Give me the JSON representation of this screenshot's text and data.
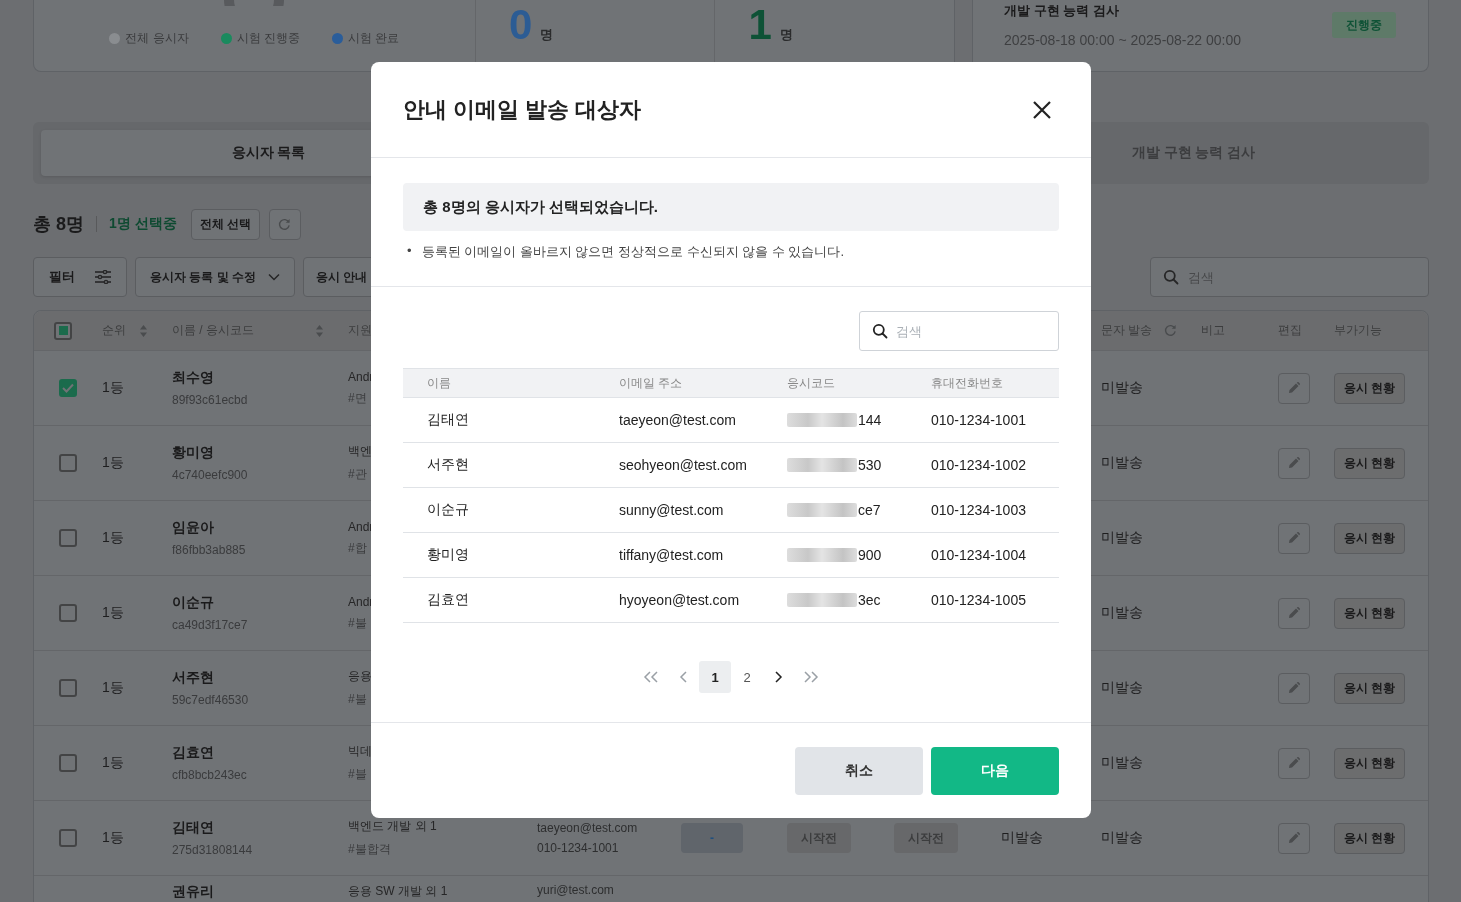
{
  "summary": {
    "legend": [
      {
        "label": "전체 응시자",
        "color": "#8a8d90"
      },
      {
        "label": "시험 진행중",
        "color": "#1a8a5e"
      },
      {
        "label": "시험 완료",
        "color": "#2a5d9a"
      }
    ],
    "stats": [
      {
        "value": "0",
        "unit": "명",
        "color": "#2c5c94"
      },
      {
        "value": "1",
        "unit": "명",
        "color": "#0e5236"
      }
    ],
    "exam": {
      "title": "개발 구현 능력 검사",
      "period": "2025-08-18 00:00 ~ 2025-08-22 00:00",
      "status": "진행중"
    }
  },
  "tabs": [
    {
      "label": "응시자 목록",
      "selected": true
    },
    {
      "label": "개발 구현 능력 검사",
      "selected": false
    }
  ],
  "toolbar": {
    "total": "총 8명",
    "selected_count": "1명 선택중",
    "select_all_button": "전체 선택",
    "filter_button": "필터",
    "register_dropdown": "응시자 등록 및 수정",
    "guide_button": "응시 안내",
    "search": {
      "placeholder": "검색"
    }
  },
  "table": {
    "select_all_indeterminate": true,
    "columns": [
      "순위",
      "이름 / 응시코드",
      "지원",
      "문자 발송",
      "비고",
      "편집",
      "부가기능"
    ],
    "rows": [
      {
        "checked": true,
        "rank": "1등",
        "name": "최수영",
        "code": "89f93c61ecbd",
        "support": [
          "Andr",
          "#면"
        ],
        "sms_status": "미발송",
        "status_button": "응시 현황"
      },
      {
        "checked": false,
        "rank": "1등",
        "name": "황미영",
        "code": "4c740eefc900",
        "support": [
          "백엔",
          "#관"
        ],
        "sms_status": "미발송",
        "status_button": "응시 현황"
      },
      {
        "checked": false,
        "rank": "1등",
        "name": "임윤아",
        "code": "f86fbb3ab885",
        "support": [
          "Andr",
          "#합"
        ],
        "sms_status": "미발송",
        "status_button": "응시 현황"
      },
      {
        "checked": false,
        "rank": "1등",
        "name": "이순규",
        "code": "ca49d3f17ce7",
        "support": [
          "Andr",
          "#불"
        ],
        "sms_status": "미발송",
        "status_button": "응시 현황"
      },
      {
        "checked": false,
        "rank": "1등",
        "name": "서주현",
        "code": "59c7edf46530",
        "support": [
          "응용",
          "#불"
        ],
        "sms_status": "미발송",
        "status_button": "응시 현황"
      },
      {
        "checked": false,
        "rank": "1등",
        "name": "김효연",
        "code": "cfb8bcb243ec",
        "support": [
          "빅데",
          "#블"
        ],
        "sms_status": "미발송",
        "status_button": "응시 현황"
      },
      {
        "checked": false,
        "rank": "1등",
        "name": "김태연",
        "code": "275d31808144",
        "support": [
          "백엔드 개발 외 1",
          "#불합격"
        ],
        "column_5": [
          "taeyeon@test.com",
          "010-1234-1001"
        ],
        "column_6": "-",
        "column_7": "시작전",
        "column_8": "시작전",
        "column_9": "미발송",
        "sms_status": "미발송",
        "status_button": "응시 현황"
      },
      {
        "name": "권유리",
        "support": [
          "응용 SW 개발 외 1"
        ],
        "column_5": [
          "yuri@test.com"
        ]
      }
    ]
  },
  "modal": {
    "title": "안내 이메일 발송 대상자",
    "summary": "총 8명의 응시자가 선택되었습니다.",
    "notes": [
      {
        "bullet": "•",
        "text": "등록된 이메일이 올바르지 않으면 정상적으로 수신되지 않을 수 있습니다."
      }
    ],
    "search": {
      "placeholder": "검색"
    },
    "columns": [
      "이름",
      "이메일 주소",
      "응시코드",
      "휴대전화번호"
    ],
    "rows": [
      {
        "name": "김태연",
        "email": "taeyeon@test.com",
        "code": "144",
        "phone": "010-1234-1001"
      },
      {
        "name": "서주현",
        "email": "seohyeon@test.com",
        "code": "530",
        "phone": "010-1234-1002"
      },
      {
        "name": "이순규",
        "email": "sunny@test.com",
        "code": "ce7",
        "phone": "010-1234-1003"
      },
      {
        "name": "황미영",
        "email": "tiffany@test.com",
        "code": "900",
        "phone": "010-1234-1004"
      },
      {
        "name": "김효연",
        "email": "hyoyeon@test.com",
        "code": "3ec",
        "phone": "010-1234-1005"
      }
    ],
    "pagination": [
      {
        "label": "1",
        "selected": true
      },
      {
        "label": "2",
        "selected": false
      }
    ],
    "buttons": [
      {
        "label": "취소",
        "kind": "secondary"
      },
      {
        "label": "다음",
        "kind": "primary"
      }
    ]
  }
}
